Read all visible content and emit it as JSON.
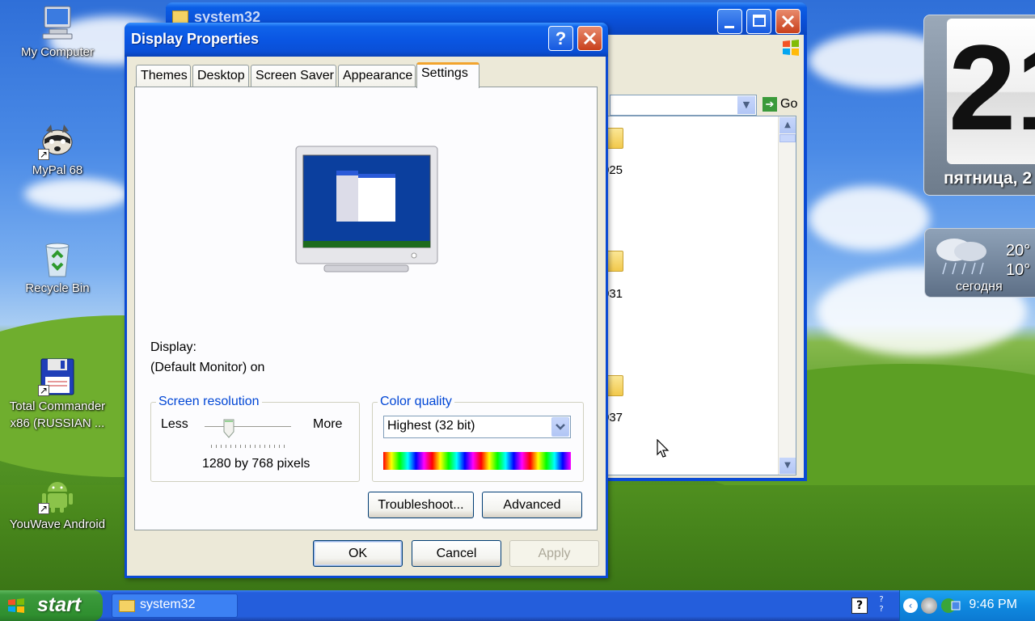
{
  "desktop": {
    "icons": [
      {
        "label": "My Computer"
      },
      {
        "label": "MyPal 68"
      },
      {
        "label": "Recycle Bin"
      },
      {
        "label": "Total Commander x86 (RUSSIAN ..."
      },
      {
        "label": "YouWave Android"
      }
    ]
  },
  "explorer": {
    "title": "system32",
    "go_label": "Go",
    "items": [
      {
        "label": "025"
      },
      {
        "label": "031"
      },
      {
        "label": "037"
      }
    ]
  },
  "gadgets": {
    "clock_digits": "21",
    "day_label": "пятница, 2",
    "weather_high": "20°",
    "weather_low": "10°",
    "weather_day": "сегодня"
  },
  "dialog": {
    "title": "Display Properties",
    "help_label": "?",
    "tabs": [
      {
        "label": "Themes"
      },
      {
        "label": "Desktop"
      },
      {
        "label": "Screen Saver"
      },
      {
        "label": "Appearance"
      },
      {
        "label": "Settings"
      }
    ],
    "active_tab": "Settings",
    "display_label": "Display:",
    "display_value": "(Default Monitor) on",
    "resolution": {
      "title": "Screen resolution",
      "less_label": "Less",
      "more_label": "More",
      "value_text": "1280 by 768 pixels"
    },
    "color_quality": {
      "title": "Color quality",
      "selected": "Highest (32 bit)"
    },
    "buttons": {
      "troubleshoot": "Troubleshoot...",
      "advanced": "Advanced",
      "ok": "OK",
      "cancel": "Cancel",
      "apply": "Apply"
    }
  },
  "taskbar": {
    "start_label": "start",
    "task_label": "system32",
    "clock": "9:46 PM"
  }
}
